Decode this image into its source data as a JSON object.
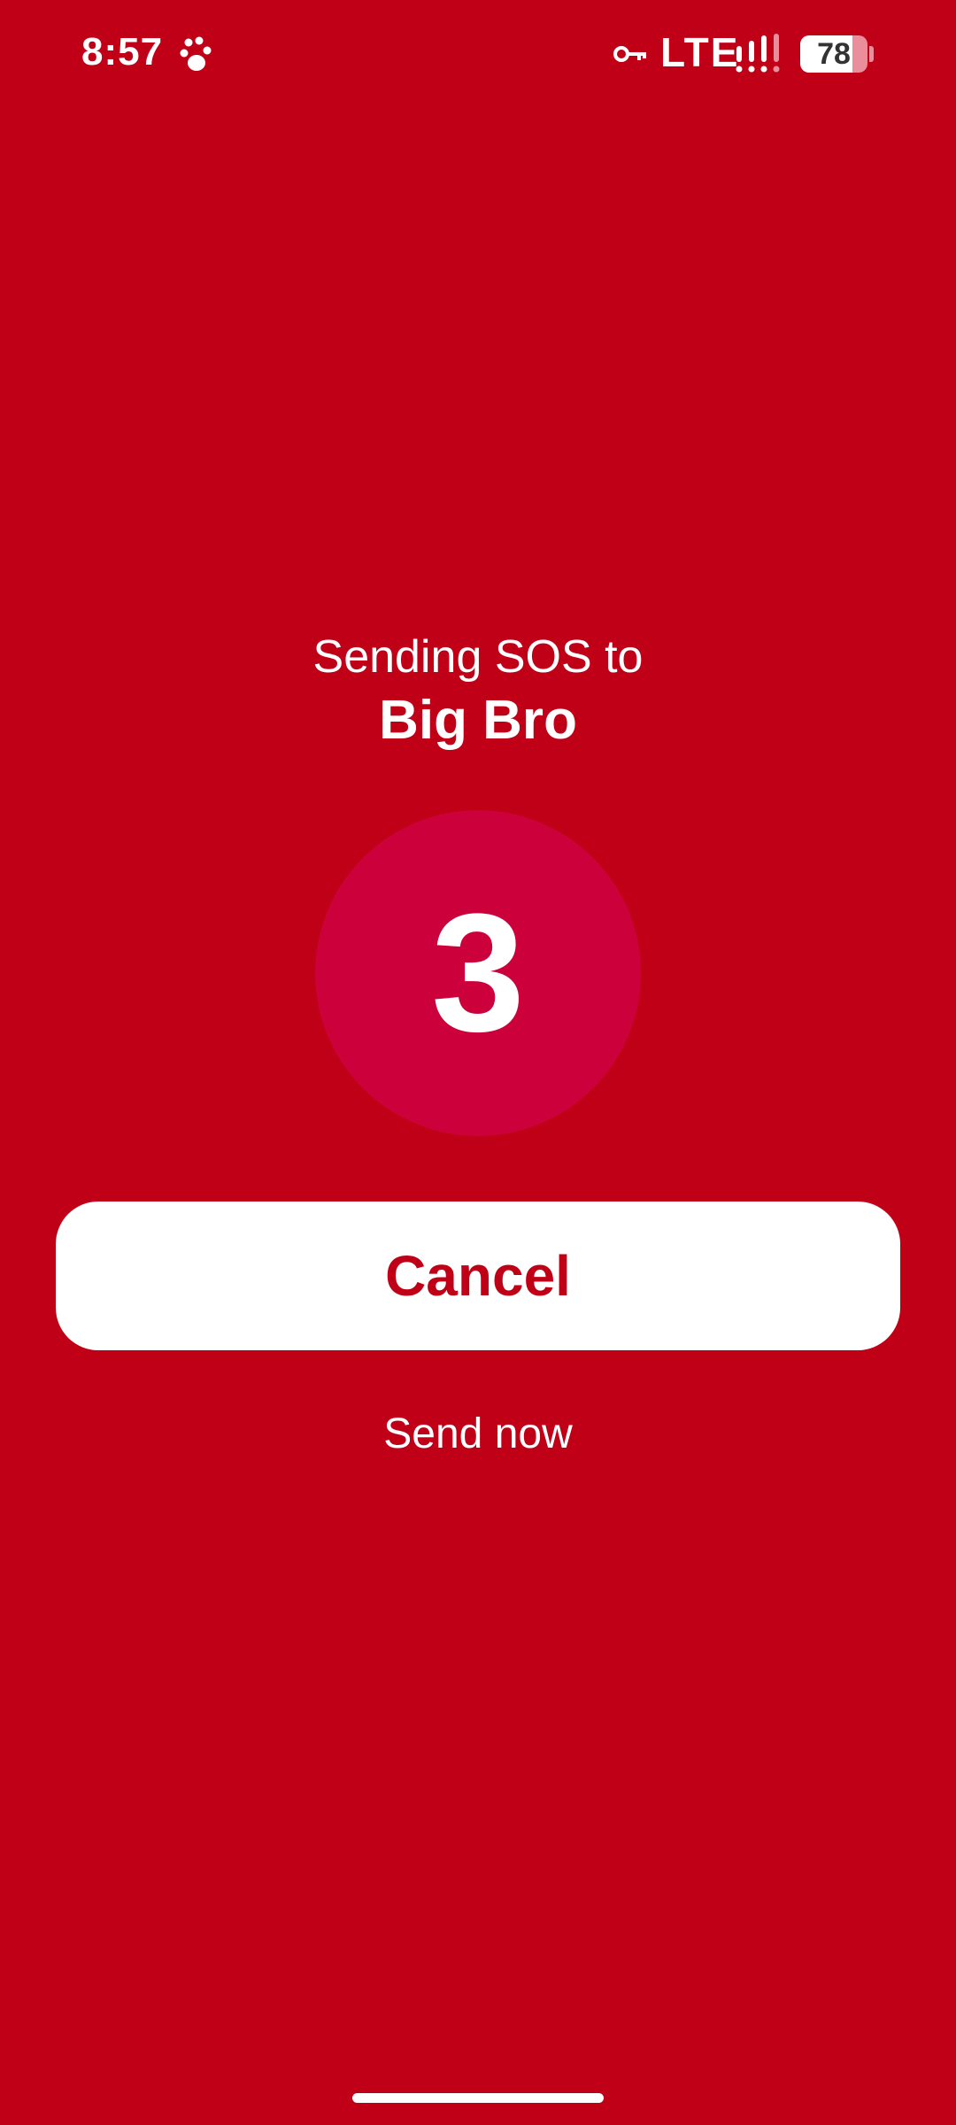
{
  "status_bar": {
    "time": "8:57",
    "network": "LTE",
    "battery_level": "78",
    "battery_fraction": 0.78,
    "icons": [
      "paw-icon",
      "key-icon",
      "signal-icon",
      "battery-icon"
    ]
  },
  "sos": {
    "sending_label": "Sending SOS to",
    "recipient": "Big Bro",
    "countdown": "3"
  },
  "actions": {
    "cancel_label": "Cancel",
    "send_now_label": "Send now"
  },
  "colors": {
    "background": "#C00017",
    "circle": "#CC003A",
    "button_bg": "#FFFFFF",
    "button_text": "#C00017"
  }
}
